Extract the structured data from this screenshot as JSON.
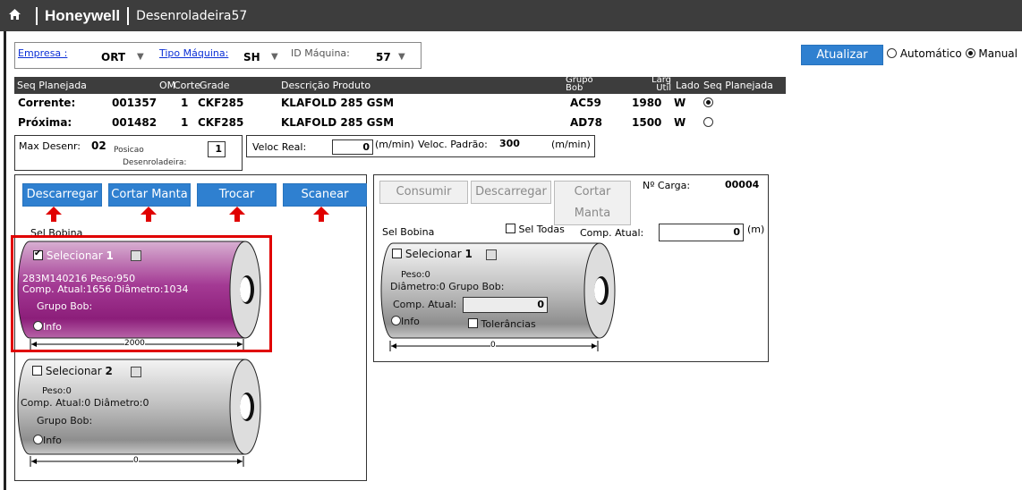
{
  "header": {
    "home_icon": "home-icon",
    "brand": "Honeywell",
    "page": "Desenroladeira57"
  },
  "filters": {
    "empresa_label": "Empresa :",
    "empresa_value": "ORT",
    "tipo_label": "Tipo Máquina:",
    "tipo_value": "SH",
    "id_label": "ID Máquina:",
    "id_value": "57"
  },
  "actions": {
    "atualizar": "Atualizar",
    "automatico": "Automático",
    "manual": "Manual"
  },
  "table": {
    "headers": {
      "seq": "Seq Planejada",
      "om": "OM",
      "corte": "Corte",
      "grade": "Grade",
      "desc": "Descrição Produto",
      "grupo": "Grupo Bob",
      "larg": "Larg Util",
      "lado": "Lado",
      "seqp": "Seq Planejada"
    },
    "rows": [
      {
        "label": "Corrente:",
        "om": "001357",
        "corte": "1",
        "grade": "CKF285",
        "desc": "KLAFOLD 285 GSM",
        "grupo": "AC59",
        "larg": "1980",
        "lado": "W",
        "selected": true
      },
      {
        "label": "Próxima:",
        "om": "001482",
        "corte": "1",
        "grade": "CKF285",
        "desc": "KLAFOLD 285 GSM",
        "grupo": "AD78",
        "larg": "1500",
        "lado": "W",
        "selected": false
      }
    ]
  },
  "info": {
    "max_label": "Max Desenr:",
    "max_value": "02",
    "posicao_label1": "Posicao",
    "posicao_label2": "Desenroladeira:",
    "posicao_value": "1",
    "veloc_real_label": "Veloc Real:",
    "veloc_real_value": "0",
    "unit": "(m/min)",
    "veloc_padrao_label": "Veloc. Padrão:",
    "veloc_padrao_value": "300",
    "unit2": "(m/min)"
  },
  "left_panel": {
    "buttons": {
      "descarregar": "Descarregar",
      "cortar": "Cortar Manta",
      "trocar": "Trocar",
      "scanear": "Scanear"
    },
    "sel_bobina": "Sel Bobina",
    "bob1": {
      "selecionar": "Selecionar",
      "num": "1",
      "line1": "283M140216  Peso:950",
      "line2": "Comp. Atual:1656  Diâmetro:1034",
      "grupo": "Grupo Bob:",
      "info": "Info",
      "width": "2000",
      "body_color": "#a0288f"
    },
    "bob2": {
      "selecionar": "Selecionar",
      "num": "2",
      "peso": "Peso:0",
      "line2": "Comp. Atual:0  Diâmetro:0",
      "grupo": "Grupo Bob:",
      "info": "Info",
      "width": "0"
    }
  },
  "right_panel": {
    "buttons": {
      "consumir": "Consumir",
      "descarregar": "Descarregar",
      "cortar": "Cortar Manta"
    },
    "carga_label": "Nº Carga:",
    "carga_value": "00004",
    "sel_bobina": "Sel Bobina",
    "sel_todas": "Sel Todas",
    "comp_label": "Comp. Atual:",
    "comp_value": "0",
    "comp_unit": "(m)",
    "bob": {
      "selecionar": "Selecionar",
      "num": "1",
      "peso": "Peso:0",
      "line2": "Diâmetro:0  Grupo Bob:",
      "comp": "Comp. Atual:",
      "comp_value": "0",
      "info": "Info",
      "tol": "Tolerâncias",
      "width": "0"
    }
  }
}
